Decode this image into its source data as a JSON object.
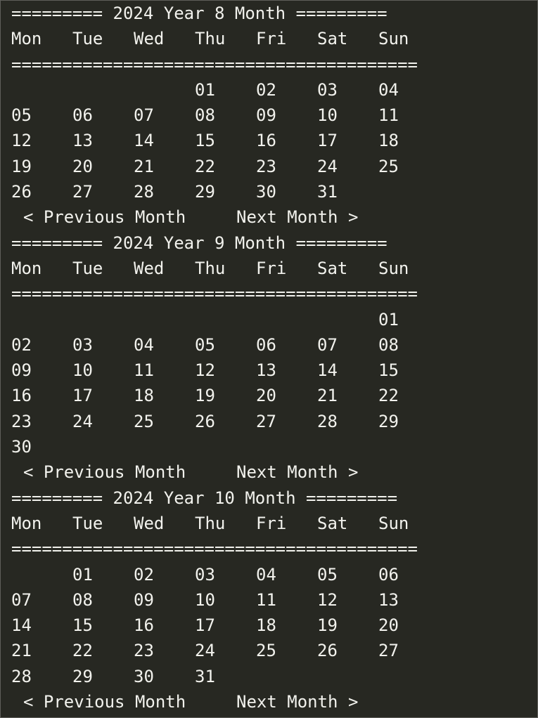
{
  "weekdays": [
    "Mon",
    "Tue",
    "Wed",
    "Thu",
    "Fri",
    "Sat",
    "Sun"
  ],
  "separator": "========================================",
  "nav": {
    "previous": "< Previous Month",
    "next": "Next Month >"
  },
  "months": [
    {
      "title": "========= 2024 Year 8 Month =========",
      "weeks": [
        [
          "",
          "",
          "",
          "01",
          "02",
          "03",
          "04"
        ],
        [
          "05",
          "06",
          "07",
          "08",
          "09",
          "10",
          "11"
        ],
        [
          "12",
          "13",
          "14",
          "15",
          "16",
          "17",
          "18"
        ],
        [
          "19",
          "20",
          "21",
          "22",
          "23",
          "24",
          "25"
        ],
        [
          "26",
          "27",
          "28",
          "29",
          "30",
          "31",
          ""
        ]
      ]
    },
    {
      "title": "========= 2024 Year 9 Month =========",
      "weeks": [
        [
          "",
          "",
          "",
          "",
          "",
          "",
          "01"
        ],
        [
          "02",
          "03",
          "04",
          "05",
          "06",
          "07",
          "08"
        ],
        [
          "09",
          "10",
          "11",
          "12",
          "13",
          "14",
          "15"
        ],
        [
          "16",
          "17",
          "18",
          "19",
          "20",
          "21",
          "22"
        ],
        [
          "23",
          "24",
          "25",
          "26",
          "27",
          "28",
          "29"
        ],
        [
          "30",
          "",
          "",
          "",
          "",
          "",
          ""
        ]
      ]
    },
    {
      "title": "========= 2024 Year 10 Month =========",
      "weeks": [
        [
          "",
          "01",
          "02",
          "03",
          "04",
          "05",
          "06"
        ],
        [
          "07",
          "08",
          "09",
          "10",
          "11",
          "12",
          "13"
        ],
        [
          "14",
          "15",
          "16",
          "17",
          "18",
          "19",
          "20"
        ],
        [
          "21",
          "22",
          "23",
          "24",
          "25",
          "26",
          "27"
        ],
        [
          "28",
          "29",
          "30",
          "31",
          "",
          "",
          ""
        ]
      ]
    }
  ]
}
